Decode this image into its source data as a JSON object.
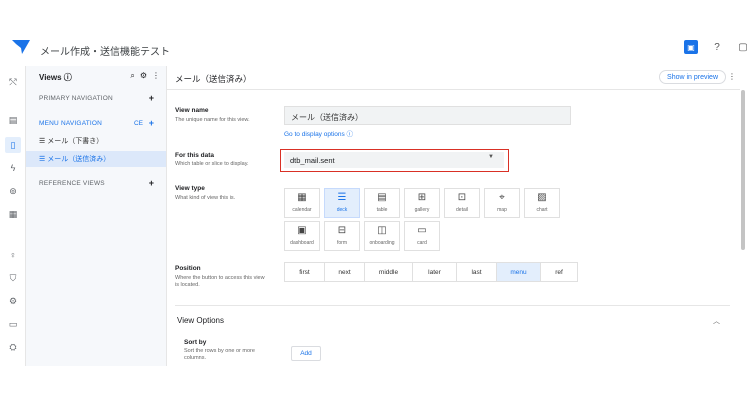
{
  "header": {
    "app_title": "メール作成・送信機能テスト",
    "icons": [
      "preview-icon",
      "help-icon",
      "window-icon"
    ]
  },
  "rail": {
    "icons": [
      "share-icon",
      "table-icon",
      "mobile-icon",
      "flash-icon",
      "automation-icon",
      "list-icon",
      "lightbulb-icon",
      "security-icon",
      "settings-icon",
      "monitor-icon",
      "learn-icon"
    ]
  },
  "views": {
    "title": "Views ⓘ",
    "primary_navigation": "PRIMARY NAVIGATION",
    "menu_navigation": "MENU NAVIGATION",
    "menu_tag": "CE",
    "items": [
      {
        "label": "☰ メール（下書き）"
      },
      {
        "label": "☰ メール（送信済み）"
      }
    ],
    "reference_views": "REFERENCE VIEWS",
    "plus": "+"
  },
  "main": {
    "title": "メール（送信済み）",
    "show_in_preview": "Show in preview",
    "view_name": {
      "label": "View name",
      "help": "The unique name for this view.",
      "value": "メール（送信済み）",
      "link": "Go to display options ⓘ"
    },
    "for_this_data": {
      "label": "For this data",
      "help": "Which table or slice to display.",
      "value": "dtb_mail.sent"
    },
    "view_type": {
      "label": "View type",
      "help": "What kind of view this is.",
      "options": [
        {
          "name": "calendar",
          "icon": "▦"
        },
        {
          "name": "deck",
          "icon": "☰"
        },
        {
          "name": "table",
          "icon": "▤"
        },
        {
          "name": "gallery",
          "icon": "⊞"
        },
        {
          "name": "detail",
          "icon": "⊡"
        },
        {
          "name": "map",
          "icon": "⌖"
        },
        {
          "name": "chart",
          "icon": "▨"
        },
        {
          "name": "dashboard",
          "icon": "▣"
        },
        {
          "name": "form",
          "icon": "⊟"
        },
        {
          "name": "onboarding",
          "icon": "◫"
        },
        {
          "name": "card",
          "icon": "▭"
        }
      ],
      "selected": "deck"
    },
    "position": {
      "label": "Position",
      "help": "Where the button to access this view is located.",
      "options": [
        "first",
        "next",
        "middle",
        "later",
        "last",
        "menu",
        "ref"
      ],
      "selected": "menu"
    },
    "view_options": {
      "title": "View Options",
      "sort_by": {
        "label": "Sort by",
        "help": "Sort the rows by one or more columns.",
        "add": "Add"
      }
    }
  },
  "colors": {
    "accent": "#1a73e8",
    "highlight_border": "#d93025",
    "selected_bg": "#e3eefc"
  }
}
